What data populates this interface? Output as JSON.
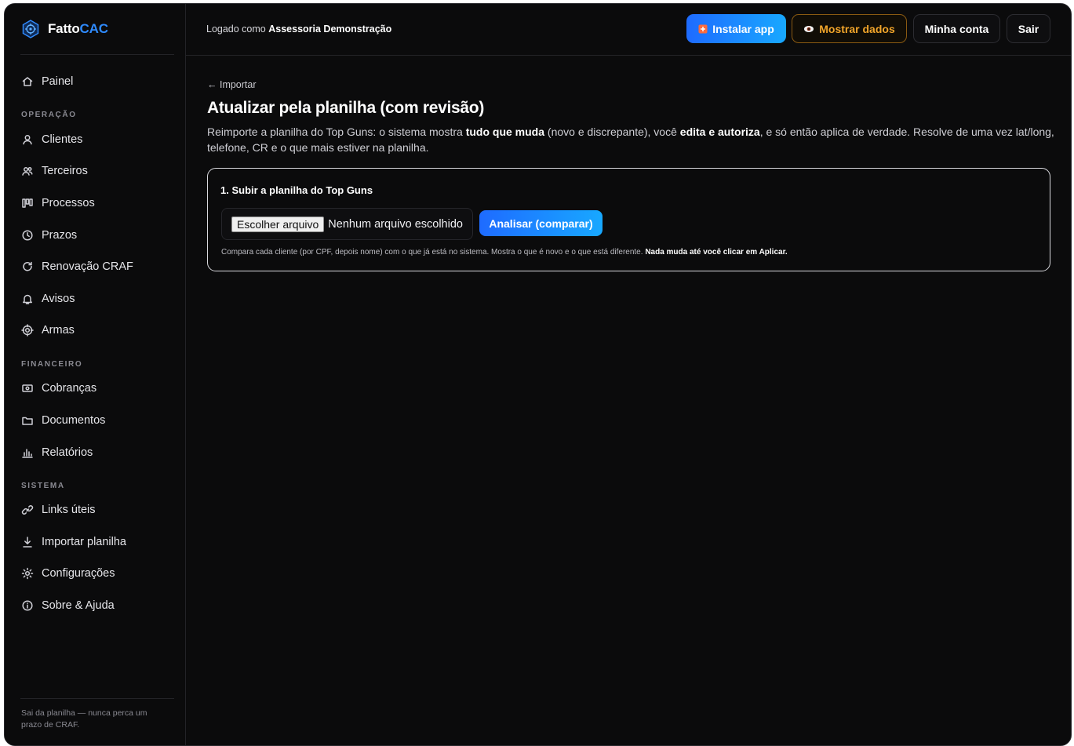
{
  "brand": {
    "name_main": "Fatto",
    "name_accent": "CAC"
  },
  "sidebar": {
    "items": [
      {
        "label": "Painel",
        "icon": "home-icon"
      },
      {
        "label": "Clientes",
        "icon": "user-icon"
      },
      {
        "label": "Terceiros",
        "icon": "users-icon"
      },
      {
        "label": "Processos",
        "icon": "kanban-icon"
      },
      {
        "label": "Prazos",
        "icon": "clock-icon"
      },
      {
        "label": "Renovação CRAF",
        "icon": "refresh-icon"
      },
      {
        "label": "Avisos",
        "icon": "bell-icon"
      },
      {
        "label": "Armas",
        "icon": "crosshair-icon"
      },
      {
        "label": "Cobranças",
        "icon": "money-icon"
      },
      {
        "label": "Documentos",
        "icon": "folder-icon"
      },
      {
        "label": "Relatórios",
        "icon": "bar-chart-icon"
      },
      {
        "label": "Links úteis",
        "icon": "link-icon"
      },
      {
        "label": "Importar planilha",
        "icon": "download-icon"
      },
      {
        "label": "Configurações",
        "icon": "sun-gear-icon"
      },
      {
        "label": "Sobre & Ajuda",
        "icon": "info-icon"
      }
    ],
    "sections": [
      "OPERAÇÃO",
      "FINANCEIRO",
      "SISTEMA"
    ],
    "footer": "Sai da planilha — nunca perca um prazo de CRAF."
  },
  "topbar": {
    "logged_prefix": "Logado como ",
    "logged_user": "Assessoria Demonstração",
    "install_label": "Instalar app",
    "show_label": "Mostrar dados",
    "account_label": "Minha conta",
    "exit_label": "Sair"
  },
  "main": {
    "back_link": "← Importar",
    "title": "Atualizar pela planilha (com revisão)",
    "desc_1": "Reimporte a planilha do Top Guns: o sistema mostra ",
    "desc_b1": "tudo que muda",
    "desc_2": " (novo e discrepante), você ",
    "desc_b2": "edita e autoriza",
    "desc_3": ", e só então aplica de verdade. Resolve de uma vez lat/long, telefone, CR e o que mais estiver na planilha.",
    "card": {
      "title": "1. Subir a planilha do Top Guns",
      "file_button": "Escolher arquivo",
      "file_status": "Nenhum arquivo escolhido",
      "analyze_label": "Analisar (comparar)",
      "note": "Compara cada cliente (por CPF, depois nome) com o que já está no sistema. Mostra o que é novo e o que está diferente. ",
      "note_bold": "Nada muda até você clicar em Aplicar."
    }
  },
  "colors": {
    "accent_blue": "#1e6bff",
    "accent_orange": "#f2a52a",
    "background": "#0b0b0c"
  }
}
